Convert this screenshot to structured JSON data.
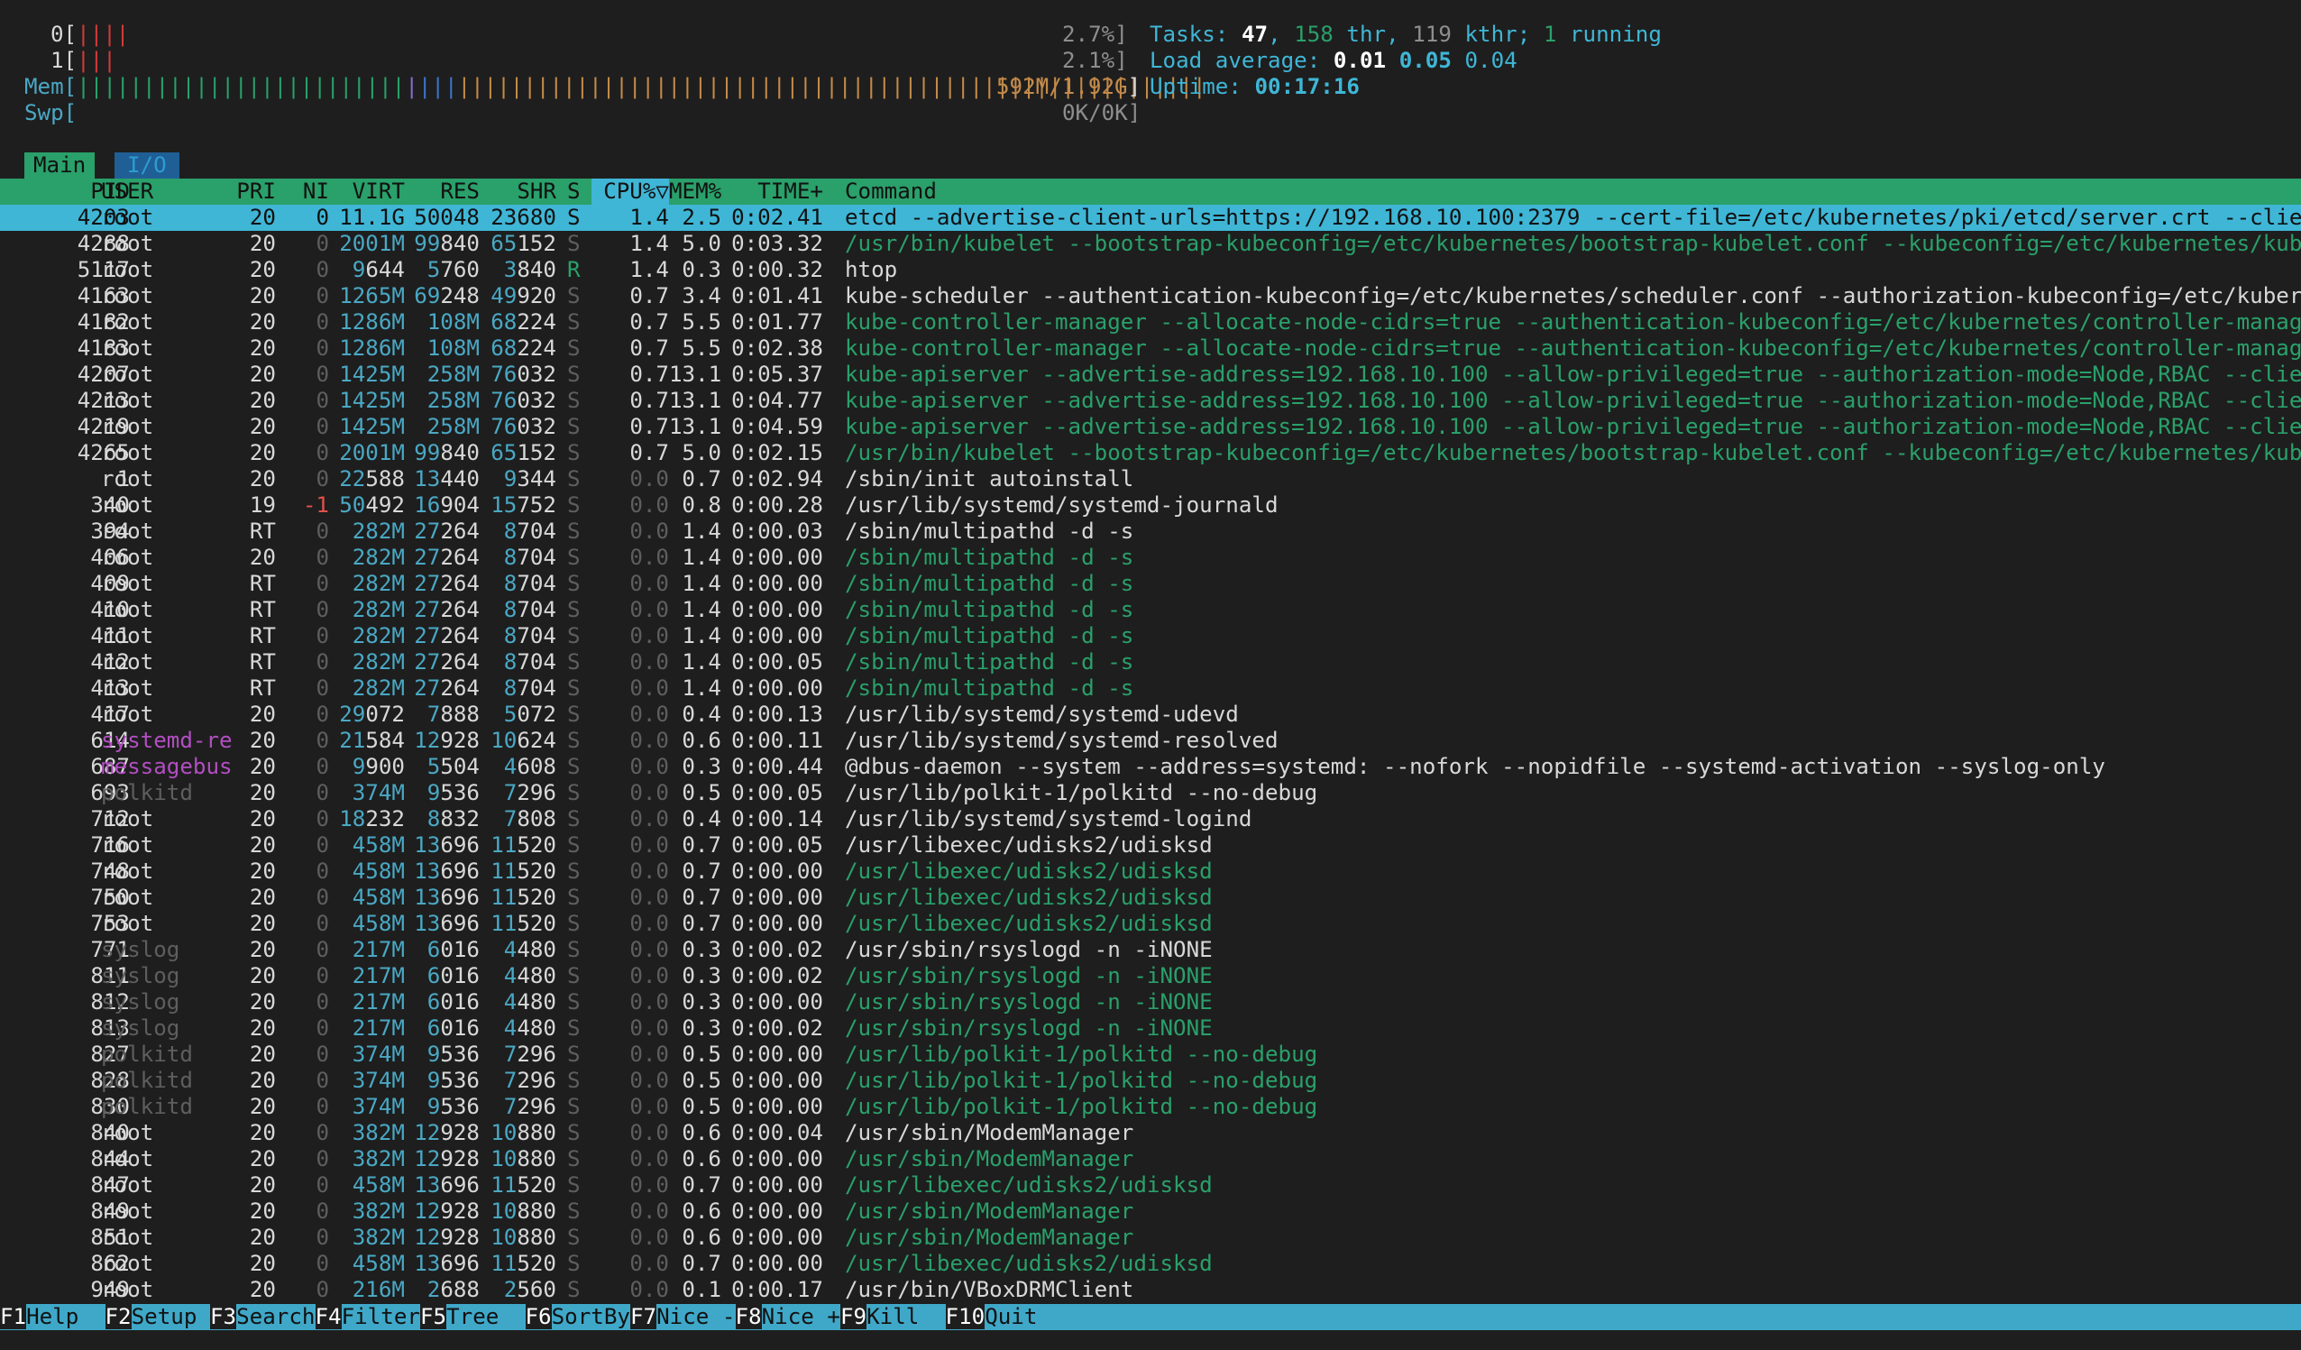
{
  "meters": {
    "cpu0": {
      "label": "0[",
      "bars": "||||",
      "value": "2.7%]"
    },
    "cpu1": {
      "label": "1[",
      "bars": "|||",
      "value": "2.1%]"
    },
    "mem": {
      "label": "Mem[",
      "bars_green": "|||||||||||||||||||||||||",
      "bars_purple": "|",
      "bars_blue": "|||",
      "bars_orange": "|||||||||||||||||||||||||||||||||||||||||||||||||||||||||",
      "value": "592M/1.92G",
      "close": "]"
    },
    "swp": {
      "label": "Swp[",
      "value": "0K/0K]"
    }
  },
  "tasks": {
    "label": "Tasks: ",
    "tasks": "47",
    "sep1": ", ",
    "thr": "158",
    "thr_label": " thr, ",
    "kthr": "119",
    "kthr_label": " kthr; ",
    "running": "1",
    "running_label": " running"
  },
  "load": {
    "label": "Load average: ",
    "one": "0.01",
    "five": "0.05",
    "fifteen": "0.04"
  },
  "uptime": {
    "label": "Uptime: ",
    "value": "00:17:16"
  },
  "tabs": [
    "Main",
    "I/O"
  ],
  "columns": {
    "pid": "PID",
    "user": "USER",
    "pri": "PRI",
    "ni": "NI",
    "virt": "VIRT",
    "res": "RES",
    "shr": "SHR",
    "s": "S",
    "cpu": "CPU%▽",
    "mem": "MEM%",
    "time": "TIME+",
    "command": "Command"
  },
  "processes": [
    {
      "pid": "4203",
      "user": "root",
      "pri": "20",
      "ni": "0",
      "virt": "11.1G",
      "res": "50048",
      "shr": "23680",
      "s": "S",
      "cpu": "1.4",
      "mem": "2.5",
      "time": "0:02.41",
      "cmd": "etcd --advertise-client-urls=https://192.168.10.100:2379 --cert-file=/etc/kubernetes/pki/etcd/server.crt --client-c",
      "selected": true
    },
    {
      "pid": "4288",
      "user": "root",
      "pri": "20",
      "ni": "0",
      "virt": "2001M",
      "res": "99840",
      "shr": "65152",
      "s": "S",
      "cpu": "1.4",
      "mem": "5.0",
      "time": "0:03.32",
      "cmd": "/usr/bin/kubelet --bootstrap-kubeconfig=/etc/kubernetes/bootstrap-kubelet.conf --kubeconfig=/etc/kubernetes/kubelet",
      "thread": true
    },
    {
      "pid": "5117",
      "user": "root",
      "pri": "20",
      "ni": "0",
      "virt": "9644",
      "res": "5760",
      "shr": "3840",
      "s": "R",
      "cpu": "1.4",
      "mem": "0.3",
      "time": "0:00.32",
      "cmd": "htop"
    },
    {
      "pid": "4163",
      "user": "root",
      "pri": "20",
      "ni": "0",
      "virt": "1265M",
      "res": "69248",
      "shr": "49920",
      "s": "S",
      "cpu": "0.7",
      "mem": "3.4",
      "time": "0:01.41",
      "cmd": "kube-scheduler --authentication-kubeconfig=/etc/kubernetes/scheduler.conf --authorization-kubeconfig=/etc/kubernete"
    },
    {
      "pid": "4182",
      "user": "root",
      "pri": "20",
      "ni": "0",
      "virt": "1286M",
      "res": "108M",
      "shr": "68224",
      "s": "S",
      "cpu": "0.7",
      "mem": "5.5",
      "time": "0:01.77",
      "cmd": "kube-controller-manager --allocate-node-cidrs=true --authentication-kubeconfig=/etc/kubernetes/controller-manager.c",
      "thread": true
    },
    {
      "pid": "4183",
      "user": "root",
      "pri": "20",
      "ni": "0",
      "virt": "1286M",
      "res": "108M",
      "shr": "68224",
      "s": "S",
      "cpu": "0.7",
      "mem": "5.5",
      "time": "0:02.38",
      "cmd": "kube-controller-manager --allocate-node-cidrs=true --authentication-kubeconfig=/etc/kubernetes/controller-manager.c",
      "thread": true
    },
    {
      "pid": "4207",
      "user": "root",
      "pri": "20",
      "ni": "0",
      "virt": "1425M",
      "res": "258M",
      "shr": "76032",
      "s": "S",
      "cpu": "0.7",
      "mem": "13.1",
      "time": "0:05.37",
      "cmd": "kube-apiserver --advertise-address=192.168.10.100 --allow-privileged=true --authorization-mode=Node,RBAC --client-c",
      "thread": true
    },
    {
      "pid": "4213",
      "user": "root",
      "pri": "20",
      "ni": "0",
      "virt": "1425M",
      "res": "258M",
      "shr": "76032",
      "s": "S",
      "cpu": "0.7",
      "mem": "13.1",
      "time": "0:04.77",
      "cmd": "kube-apiserver --advertise-address=192.168.10.100 --allow-privileged=true --authorization-mode=Node,RBAC --client-c",
      "thread": true
    },
    {
      "pid": "4219",
      "user": "root",
      "pri": "20",
      "ni": "0",
      "virt": "1425M",
      "res": "258M",
      "shr": "76032",
      "s": "S",
      "cpu": "0.7",
      "mem": "13.1",
      "time": "0:04.59",
      "cmd": "kube-apiserver --advertise-address=192.168.10.100 --allow-privileged=true --authorization-mode=Node,RBAC --client-c",
      "thread": true
    },
    {
      "pid": "4265",
      "user": "root",
      "pri": "20",
      "ni": "0",
      "virt": "2001M",
      "res": "99840",
      "shr": "65152",
      "s": "S",
      "cpu": "0.7",
      "mem": "5.0",
      "time": "0:02.15",
      "cmd": "/usr/bin/kubelet --bootstrap-kubeconfig=/etc/kubernetes/bootstrap-kubelet.conf --kubeconfig=/etc/kubernetes/kubelet",
      "thread": true
    },
    {
      "pid": "1",
      "user": "root",
      "pri": "20",
      "ni": "0",
      "virt": "22588",
      "res": "13440",
      "shr": "9344",
      "s": "S",
      "cpu": "0.0",
      "mem": "0.7",
      "time": "0:02.94",
      "cmd": "/sbin/init autoinstall"
    },
    {
      "pid": "340",
      "user": "root",
      "pri": "19",
      "ni": "-1",
      "virt": "50492",
      "res": "16904",
      "shr": "15752",
      "s": "S",
      "cpu": "0.0",
      "mem": "0.8",
      "time": "0:00.28",
      "cmd": "/usr/lib/systemd/systemd-journald"
    },
    {
      "pid": "394",
      "user": "root",
      "pri": "RT",
      "ni": "0",
      "virt": "282M",
      "res": "27264",
      "shr": "8704",
      "s": "S",
      "cpu": "0.0",
      "mem": "1.4",
      "time": "0:00.03",
      "cmd": "/sbin/multipathd -d -s"
    },
    {
      "pid": "406",
      "user": "root",
      "pri": "20",
      "ni": "0",
      "virt": "282M",
      "res": "27264",
      "shr": "8704",
      "s": "S",
      "cpu": "0.0",
      "mem": "1.4",
      "time": "0:00.00",
      "cmd": "/sbin/multipathd -d -s",
      "thread": true
    },
    {
      "pid": "409",
      "user": "root",
      "pri": "RT",
      "ni": "0",
      "virt": "282M",
      "res": "27264",
      "shr": "8704",
      "s": "S",
      "cpu": "0.0",
      "mem": "1.4",
      "time": "0:00.00",
      "cmd": "/sbin/multipathd -d -s",
      "thread": true
    },
    {
      "pid": "410",
      "user": "root",
      "pri": "RT",
      "ni": "0",
      "virt": "282M",
      "res": "27264",
      "shr": "8704",
      "s": "S",
      "cpu": "0.0",
      "mem": "1.4",
      "time": "0:00.00",
      "cmd": "/sbin/multipathd -d -s",
      "thread": true
    },
    {
      "pid": "411",
      "user": "root",
      "pri": "RT",
      "ni": "0",
      "virt": "282M",
      "res": "27264",
      "shr": "8704",
      "s": "S",
      "cpu": "0.0",
      "mem": "1.4",
      "time": "0:00.00",
      "cmd": "/sbin/multipathd -d -s",
      "thread": true
    },
    {
      "pid": "412",
      "user": "root",
      "pri": "RT",
      "ni": "0",
      "virt": "282M",
      "res": "27264",
      "shr": "8704",
      "s": "S",
      "cpu": "0.0",
      "mem": "1.4",
      "time": "0:00.05",
      "cmd": "/sbin/multipathd -d -s",
      "thread": true
    },
    {
      "pid": "413",
      "user": "root",
      "pri": "RT",
      "ni": "0",
      "virt": "282M",
      "res": "27264",
      "shr": "8704",
      "s": "S",
      "cpu": "0.0",
      "mem": "1.4",
      "time": "0:00.00",
      "cmd": "/sbin/multipathd -d -s",
      "thread": true
    },
    {
      "pid": "417",
      "user": "root",
      "pri": "20",
      "ni": "0",
      "virt": "29072",
      "res": "7888",
      "shr": "5072",
      "s": "S",
      "cpu": "0.0",
      "mem": "0.4",
      "time": "0:00.13",
      "cmd": "/usr/lib/systemd/systemd-udevd"
    },
    {
      "pid": "614",
      "user": "systemd-re",
      "pri": "20",
      "ni": "0",
      "virt": "21584",
      "res": "12928",
      "shr": "10624",
      "s": "S",
      "cpu": "0.0",
      "mem": "0.6",
      "time": "0:00.11",
      "cmd": "/usr/lib/systemd/systemd-resolved",
      "userColor": "magenta"
    },
    {
      "pid": "687",
      "user": "messagebus",
      "pri": "20",
      "ni": "0",
      "virt": "9900",
      "res": "5504",
      "shr": "4608",
      "s": "S",
      "cpu": "0.0",
      "mem": "0.3",
      "time": "0:00.44",
      "cmd": "@dbus-daemon --system --address=systemd: --nofork --nopidfile --systemd-activation --syslog-only",
      "userColor": "magenta"
    },
    {
      "pid": "693",
      "user": "polkitd",
      "pri": "20",
      "ni": "0",
      "virt": "374M",
      "res": "9536",
      "shr": "7296",
      "s": "S",
      "cpu": "0.0",
      "mem": "0.5",
      "time": "0:00.05",
      "cmd": "/usr/lib/polkit-1/polkitd --no-debug",
      "userColor": "gray"
    },
    {
      "pid": "712",
      "user": "root",
      "pri": "20",
      "ni": "0",
      "virt": "18232",
      "res": "8832",
      "shr": "7808",
      "s": "S",
      "cpu": "0.0",
      "mem": "0.4",
      "time": "0:00.14",
      "cmd": "/usr/lib/systemd/systemd-logind"
    },
    {
      "pid": "716",
      "user": "root",
      "pri": "20",
      "ni": "0",
      "virt": "458M",
      "res": "13696",
      "shr": "11520",
      "s": "S",
      "cpu": "0.0",
      "mem": "0.7",
      "time": "0:00.05",
      "cmd": "/usr/libexec/udisks2/udisksd"
    },
    {
      "pid": "748",
      "user": "root",
      "pri": "20",
      "ni": "0",
      "virt": "458M",
      "res": "13696",
      "shr": "11520",
      "s": "S",
      "cpu": "0.0",
      "mem": "0.7",
      "time": "0:00.00",
      "cmd": "/usr/libexec/udisks2/udisksd",
      "thread": true
    },
    {
      "pid": "750",
      "user": "root",
      "pri": "20",
      "ni": "0",
      "virt": "458M",
      "res": "13696",
      "shr": "11520",
      "s": "S",
      "cpu": "0.0",
      "mem": "0.7",
      "time": "0:00.00",
      "cmd": "/usr/libexec/udisks2/udisksd",
      "thread": true
    },
    {
      "pid": "753",
      "user": "root",
      "pri": "20",
      "ni": "0",
      "virt": "458M",
      "res": "13696",
      "shr": "11520",
      "s": "S",
      "cpu": "0.0",
      "mem": "0.7",
      "time": "0:00.00",
      "cmd": "/usr/libexec/udisks2/udisksd",
      "thread": true
    },
    {
      "pid": "771",
      "user": "syslog",
      "pri": "20",
      "ni": "0",
      "virt": "217M",
      "res": "6016",
      "shr": "4480",
      "s": "S",
      "cpu": "0.0",
      "mem": "0.3",
      "time": "0:00.02",
      "cmd": "/usr/sbin/rsyslogd -n -iNONE",
      "userColor": "gray"
    },
    {
      "pid": "811",
      "user": "syslog",
      "pri": "20",
      "ni": "0",
      "virt": "217M",
      "res": "6016",
      "shr": "4480",
      "s": "S",
      "cpu": "0.0",
      "mem": "0.3",
      "time": "0:00.02",
      "cmd": "/usr/sbin/rsyslogd -n -iNONE",
      "thread": true,
      "userColor": "gray"
    },
    {
      "pid": "812",
      "user": "syslog",
      "pri": "20",
      "ni": "0",
      "virt": "217M",
      "res": "6016",
      "shr": "4480",
      "s": "S",
      "cpu": "0.0",
      "mem": "0.3",
      "time": "0:00.00",
      "cmd": "/usr/sbin/rsyslogd -n -iNONE",
      "thread": true,
      "userColor": "gray"
    },
    {
      "pid": "813",
      "user": "syslog",
      "pri": "20",
      "ni": "0",
      "virt": "217M",
      "res": "6016",
      "shr": "4480",
      "s": "S",
      "cpu": "0.0",
      "mem": "0.3",
      "time": "0:00.02",
      "cmd": "/usr/sbin/rsyslogd -n -iNONE",
      "thread": true,
      "userColor": "gray"
    },
    {
      "pid": "827",
      "user": "polkitd",
      "pri": "20",
      "ni": "0",
      "virt": "374M",
      "res": "9536",
      "shr": "7296",
      "s": "S",
      "cpu": "0.0",
      "mem": "0.5",
      "time": "0:00.00",
      "cmd": "/usr/lib/polkit-1/polkitd --no-debug",
      "thread": true,
      "userColor": "gray"
    },
    {
      "pid": "828",
      "user": "polkitd",
      "pri": "20",
      "ni": "0",
      "virt": "374M",
      "res": "9536",
      "shr": "7296",
      "s": "S",
      "cpu": "0.0",
      "mem": "0.5",
      "time": "0:00.00",
      "cmd": "/usr/lib/polkit-1/polkitd --no-debug",
      "thread": true,
      "userColor": "gray"
    },
    {
      "pid": "830",
      "user": "polkitd",
      "pri": "20",
      "ni": "0",
      "virt": "374M",
      "res": "9536",
      "shr": "7296",
      "s": "S",
      "cpu": "0.0",
      "mem": "0.5",
      "time": "0:00.00",
      "cmd": "/usr/lib/polkit-1/polkitd --no-debug",
      "thread": true,
      "userColor": "gray"
    },
    {
      "pid": "840",
      "user": "root",
      "pri": "20",
      "ni": "0",
      "virt": "382M",
      "res": "12928",
      "shr": "10880",
      "s": "S",
      "cpu": "0.0",
      "mem": "0.6",
      "time": "0:00.04",
      "cmd": "/usr/sbin/ModemManager"
    },
    {
      "pid": "844",
      "user": "root",
      "pri": "20",
      "ni": "0",
      "virt": "382M",
      "res": "12928",
      "shr": "10880",
      "s": "S",
      "cpu": "0.0",
      "mem": "0.6",
      "time": "0:00.00",
      "cmd": "/usr/sbin/ModemManager",
      "thread": true
    },
    {
      "pid": "847",
      "user": "root",
      "pri": "20",
      "ni": "0",
      "virt": "458M",
      "res": "13696",
      "shr": "11520",
      "s": "S",
      "cpu": "0.0",
      "mem": "0.7",
      "time": "0:00.00",
      "cmd": "/usr/libexec/udisks2/udisksd",
      "thread": true
    },
    {
      "pid": "849",
      "user": "root",
      "pri": "20",
      "ni": "0",
      "virt": "382M",
      "res": "12928",
      "shr": "10880",
      "s": "S",
      "cpu": "0.0",
      "mem": "0.6",
      "time": "0:00.00",
      "cmd": "/usr/sbin/ModemManager",
      "thread": true
    },
    {
      "pid": "851",
      "user": "root",
      "pri": "20",
      "ni": "0",
      "virt": "382M",
      "res": "12928",
      "shr": "10880",
      "s": "S",
      "cpu": "0.0",
      "mem": "0.6",
      "time": "0:00.00",
      "cmd": "/usr/sbin/ModemManager",
      "thread": true
    },
    {
      "pid": "862",
      "user": "root",
      "pri": "20",
      "ni": "0",
      "virt": "458M",
      "res": "13696",
      "shr": "11520",
      "s": "S",
      "cpu": "0.0",
      "mem": "0.7",
      "time": "0:00.00",
      "cmd": "/usr/libexec/udisks2/udisksd",
      "thread": true
    },
    {
      "pid": "949",
      "user": "root",
      "pri": "20",
      "ni": "0",
      "virt": "216M",
      "res": "2688",
      "shr": "2560",
      "s": "S",
      "cpu": "0.0",
      "mem": "0.1",
      "time": "0:00.17",
      "cmd": "/usr/bin/VBoxDRMClient"
    }
  ],
  "fkeys": [
    {
      "key": "F1",
      "label": "Help  "
    },
    {
      "key": "F2",
      "label": "Setup "
    },
    {
      "key": "F3",
      "label": "Search"
    },
    {
      "key": "F4",
      "label": "Filter"
    },
    {
      "key": "F5",
      "label": "Tree  "
    },
    {
      "key": "F6",
      "label": "SortBy"
    },
    {
      "key": "F7",
      "label": "Nice -"
    },
    {
      "key": "F8",
      "label": "Nice +"
    },
    {
      "key": "F9",
      "label": "Kill  "
    },
    {
      "key": "F10",
      "label": "Quit"
    }
  ],
  "colors": {
    "header_bg": "#2aa06a",
    "selected_bg": "#3fb6d6",
    "fkey_bg": "#3fa8c8",
    "background": "#1e1e1e"
  }
}
